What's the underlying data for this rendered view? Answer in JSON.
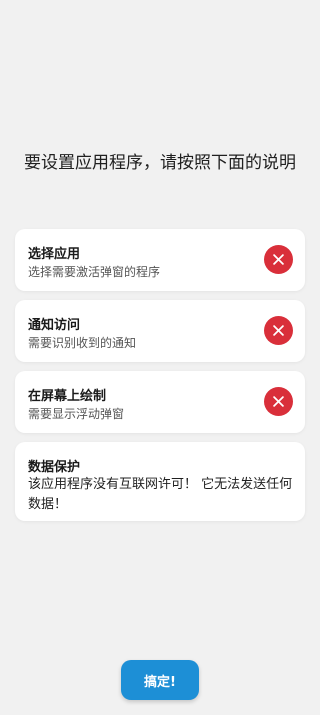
{
  "title": "要设置应用程序，请按照下面的说明",
  "items": [
    {
      "title": "选择应用",
      "desc": "选择需要激活弹窗的程序",
      "icon": "close-icon",
      "status_color": "#d92f3a"
    },
    {
      "title": "通知访问",
      "desc": "需要识别收到的通知",
      "icon": "close-icon",
      "status_color": "#d92f3a"
    },
    {
      "title": "在屏幕上绘制",
      "desc": "需要显示浮动弹窗",
      "icon": "close-icon",
      "status_color": "#d92f3a"
    }
  ],
  "data_protection": {
    "title": "数据保护",
    "desc": "该应用程序没有互联网许可！ 它无法发送任何数据！"
  },
  "done_button": {
    "label": "搞定!",
    "color": "#1d8fd6"
  }
}
